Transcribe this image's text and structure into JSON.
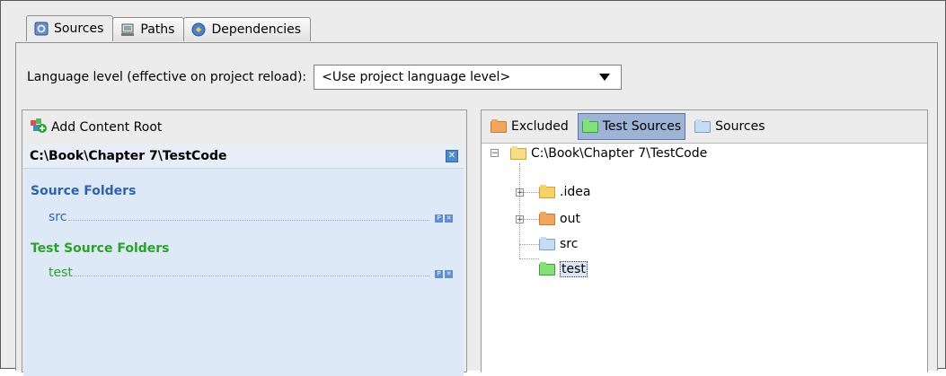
{
  "tabs": [
    {
      "label": "Sources",
      "icon": "sources-tab-icon",
      "active": true
    },
    {
      "label": "Paths",
      "icon": "paths-tab-icon",
      "active": false
    },
    {
      "label": "Dependencies",
      "icon": "dependencies-tab-icon",
      "active": false
    }
  ],
  "language": {
    "label": "Language level (effective on project reload):",
    "value": "<Use project language level>"
  },
  "content_root": {
    "add_label": "Add Content Root",
    "path": "C:\\Book\\Chapter 7\\TestCode",
    "source_folders_title": "Source Folders",
    "source_folders": [
      "src"
    ],
    "test_source_folders_title": "Test Source Folders",
    "test_source_folders": [
      "test"
    ]
  },
  "mark_buttons": {
    "excluded": "Excluded",
    "test_sources": "Test Sources",
    "sources": "Sources",
    "active": "Test Sources"
  },
  "tree": {
    "root": "C:\\Book\\Chapter 7\\TestCode",
    "children": [
      {
        "name": ".idea",
        "type": "normal"
      },
      {
        "name": "out",
        "type": "excluded"
      },
      {
        "name": "src",
        "type": "source"
      },
      {
        "name": "test",
        "type": "test",
        "selected": true
      }
    ]
  },
  "colors": {
    "source_blue": "#2f62ad",
    "test_green": "#2aa12a",
    "selection": "#9db4d6"
  }
}
